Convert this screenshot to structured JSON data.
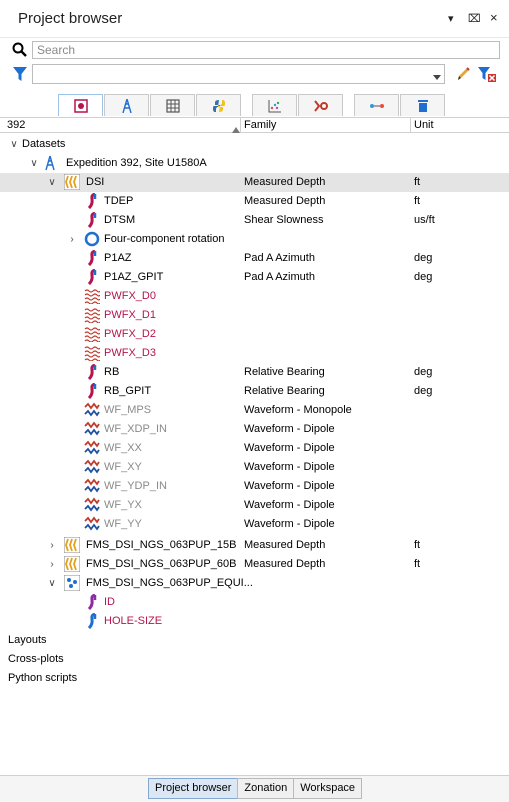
{
  "window": {
    "title": "Project browser",
    "controls": [
      "▾",
      "⌧",
      "×"
    ]
  },
  "search": {
    "placeholder": "Search"
  },
  "column_headers": {
    "name": "392",
    "family": "Family",
    "unit": "Unit"
  },
  "toolbar_icons": [
    "well-log-icon",
    "tower-icon",
    "table-icon",
    "python-icon",
    "crossplot-icon",
    "zonation-icon",
    "connector-icon",
    "trash-icon"
  ],
  "tree": {
    "datasets": "Datasets",
    "expedition": "Expedition 392, Site U1580A",
    "dsi": {
      "name": "DSI",
      "family": "Measured Depth",
      "unit": "ft"
    },
    "tdep": {
      "name": "TDEP",
      "family": "Measured Depth",
      "unit": "ft"
    },
    "dtsm": {
      "name": "DTSM",
      "family": "Shear Slowness",
      "unit": "us/ft"
    },
    "four": {
      "name": "Four-component rotation"
    },
    "p1az": {
      "name": "P1AZ",
      "family": "Pad A Azimuth",
      "unit": "deg"
    },
    "p1az_gpit": {
      "name": "P1AZ_GPIT",
      "family": "Pad A Azimuth",
      "unit": "deg"
    },
    "pwfx_d0": {
      "name": "PWFX_D0"
    },
    "pwfx_d1": {
      "name": "PWFX_D1"
    },
    "pwfx_d2": {
      "name": "PWFX_D2"
    },
    "pwfx_d3": {
      "name": "PWFX_D3"
    },
    "rb": {
      "name": "RB",
      "family": "Relative Bearing",
      "unit": "deg"
    },
    "rb_gpit": {
      "name": "RB_GPIT",
      "family": "Relative Bearing",
      "unit": "deg"
    },
    "wf_mps": {
      "name": "WF_MPS",
      "family": "Waveform - Monopole"
    },
    "wf_xdp_in": {
      "name": "WF_XDP_IN",
      "family": "Waveform - Dipole"
    },
    "wf_xx": {
      "name": "WF_XX",
      "family": "Waveform - Dipole"
    },
    "wf_xy": {
      "name": "WF_XY",
      "family": "Waveform - Dipole"
    },
    "wf_ydp_in": {
      "name": "WF_YDP_IN",
      "family": "Waveform - Dipole"
    },
    "wf_yx": {
      "name": "WF_YX",
      "family": "Waveform - Dipole"
    },
    "wf_yy": {
      "name": "WF_YY",
      "family": "Waveform - Dipole"
    },
    "fms15": {
      "name": "FMS_DSI_NGS_063PUP_15B",
      "family": "Measured Depth",
      "unit": "ft"
    },
    "fms60": {
      "name": "FMS_DSI_NGS_063PUP_60B",
      "family": "Measured Depth",
      "unit": "ft"
    },
    "fmsequi": {
      "name": "FMS_DSI_NGS_063PUP_EQUI..."
    },
    "id": {
      "name": "ID"
    },
    "hole": {
      "name": "HOLE-SIZE"
    },
    "layouts": "Layouts",
    "crossplots": "Cross-plots",
    "pyscripts": "Python scripts"
  },
  "bottom_tabs": [
    "Project browser",
    "Zonation",
    "Workspace"
  ],
  "colors": {
    "accent_red": "#b5144e",
    "accent_blue": "#1f6fd0",
    "selection": "#e4e4e4"
  }
}
